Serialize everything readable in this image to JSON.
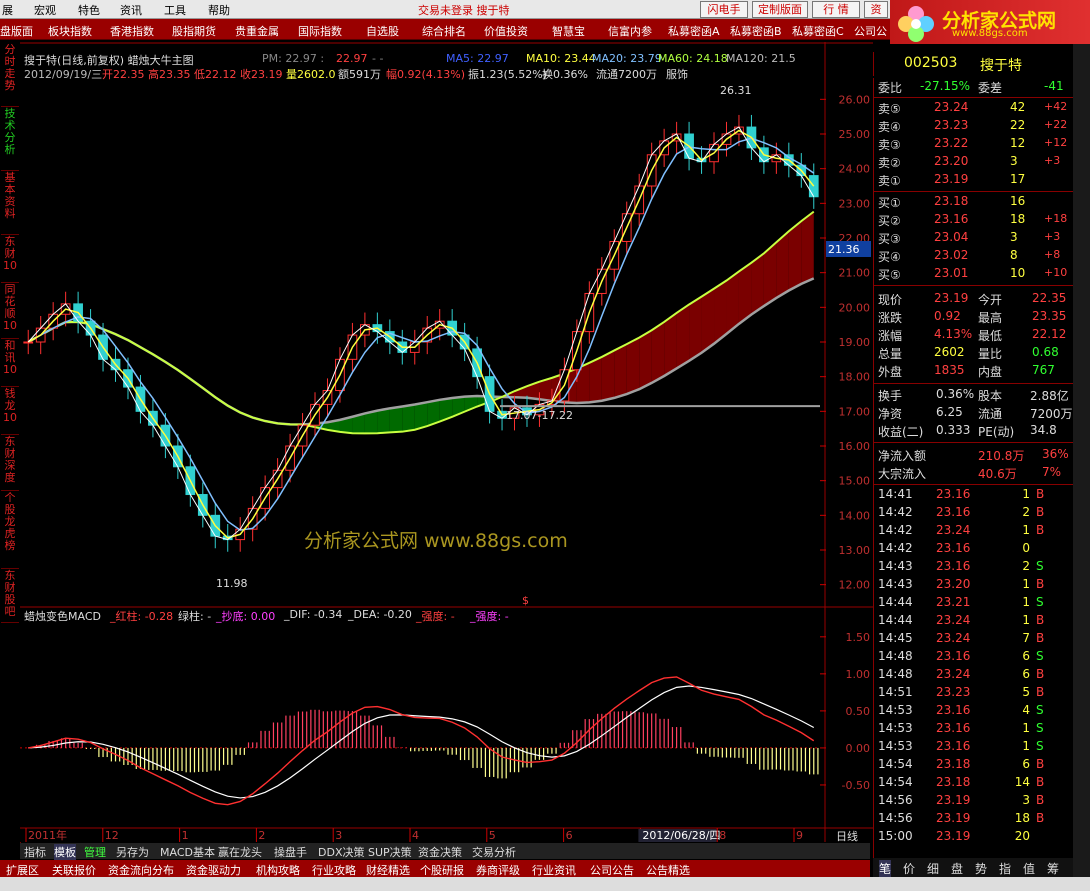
{
  "menu": {
    "items": [
      "展",
      "宏观",
      "特色",
      "资讯",
      "工具",
      "帮助"
    ],
    "status": "交易未登录 搜于特",
    "buttons": [
      "闪电手",
      "定制版面",
      "行 情",
      "资"
    ]
  },
  "nav": {
    "items": [
      "盘版面",
      "板块指数",
      "香港指数",
      "股指期货",
      "贵重金属",
      "国际指数",
      "自选股",
      "综合排名",
      "价值投资",
      "智慧宝",
      "信富内参",
      "私募密函A",
      "私募密函B",
      "私募密函C",
      "公司公"
    ]
  },
  "logo": {
    "title": "分析家公式网",
    "url": "www.88gs.com"
  },
  "left_tabs": [
    "分时走势",
    "技术分析",
    "基本资料",
    "东财10",
    "同花顺10",
    "和讯10",
    "钱龙10",
    "东财深度",
    "个股龙虎榜",
    "东财股吧"
  ],
  "chart_header": {
    "line1_title": "搜于特(日线,前复权) 蜡烛大牛主图",
    "line1_pm": "PM: 22.97 :",
    "line1_pm2": "22.97",
    "line1_dash": "- -",
    "ma5": "MA5: 22.97",
    "ma10": "MA10: 23.44",
    "ma20": "MA20: 23.79",
    "ma60": "MA60: 24.18",
    "ma120": "MA120: 21.5",
    "line2_date": "2012/09/19/三",
    "line2_open": "开22.35",
    "line2_high": "高23.35",
    "line2_low": "低22.12",
    "line2_close": "收23.19",
    "line2_vol": "量2602.0",
    "line2_amt": "额591万",
    "line2_fu": "幅0.92(4.13%)",
    "line2_zhen": "振1.23(5.52%)",
    "line2_huan": "换0.36%",
    "line2_flow": "流通7200万",
    "line2_ind": "服饰"
  },
  "chart_data": [
    {
      "type": "line",
      "title": "搜于特(日线,前复权) 蜡烛大牛主图",
      "ylim": [
        11.5,
        26.5
      ],
      "y_ticks": [
        "26.00",
        "25.00",
        "24.00",
        "23.00",
        "22.00",
        "21.00",
        "20.00",
        "19.00",
        "18.00",
        "17.00",
        "16.00",
        "15.00",
        "14.00",
        "13.00",
        "12.00"
      ],
      "x_ticks": [
        "2011年",
        "12",
        "1",
        "2",
        "3",
        "4",
        "5",
        "6",
        "2012/06/28/四",
        "8",
        "9"
      ],
      "annotations": [
        "26.31",
        "11.98",
        "17.07-17.22",
        "21.36",
        "$"
      ],
      "close": [
        19.0,
        19.4,
        19.8,
        20.1,
        19.6,
        19.2,
        18.5,
        18.2,
        17.7,
        17.0,
        16.6,
        16.0,
        15.4,
        14.6,
        14.0,
        13.4,
        13.3,
        13.6,
        14.2,
        14.8,
        15.3,
        16.0,
        16.6,
        17.2,
        17.6,
        18.5,
        19.2,
        19.5,
        19.3,
        19.0,
        18.7,
        19.0,
        19.4,
        19.6,
        19.2,
        18.8,
        18.0,
        17.0,
        16.8,
        17.1,
        16.9,
        17.2,
        17.3,
        18.2,
        19.3,
        20.4,
        21.1,
        21.9,
        22.7,
        23.5,
        24.4,
        24.8,
        25.0,
        24.3,
        24.2,
        24.7,
        25.0,
        25.2,
        24.6,
        24.2,
        24.4,
        24.1,
        23.8,
        23.19
      ]
    },
    {
      "type": "bar",
      "title": "蜡烛变色MACD",
      "ylim": [
        -1.0,
        1.7
      ],
      "y_ticks": [
        "1.50",
        "1.00",
        "0.50",
        "0.00",
        "-0.50"
      ],
      "labels": {
        "red": "_红柱: -0.28",
        "green": "绿柱: -",
        "chaodi": "_抄底: 0.00",
        "dif": "_DIF: -0.34",
        "dea": "_DEA: -0.20",
        "qiangdu1": "_强度: -",
        "qiangdu2": "_强度: -"
      }
    }
  ],
  "right_panel": {
    "code": "002503",
    "name": "搜于特",
    "weibi_label": "委比",
    "weibi": "-27.15%",
    "weicha_label": "委差",
    "weicha": "-41",
    "sell": [
      {
        "label": "卖⑤",
        "price": "23.24",
        "vol": "42",
        "chg": "+42"
      },
      {
        "label": "卖④",
        "price": "23.23",
        "vol": "22",
        "chg": "+22"
      },
      {
        "label": "卖③",
        "price": "23.22",
        "vol": "12",
        "chg": "+12"
      },
      {
        "label": "卖②",
        "price": "23.20",
        "vol": "3",
        "chg": "+3"
      },
      {
        "label": "卖①",
        "price": "23.19",
        "vol": "17",
        "chg": ""
      }
    ],
    "buy": [
      {
        "label": "买①",
        "price": "23.18",
        "vol": "16",
        "chg": ""
      },
      {
        "label": "买②",
        "price": "23.16",
        "vol": "18",
        "chg": "+18"
      },
      {
        "label": "买③",
        "price": "23.04",
        "vol": "3",
        "chg": "+3"
      },
      {
        "label": "买④",
        "price": "23.02",
        "vol": "8",
        "chg": "+8"
      },
      {
        "label": "买⑤",
        "price": "23.01",
        "vol": "10",
        "chg": "+10"
      }
    ],
    "quote": [
      {
        "l1": "现价",
        "v1": "23.19",
        "l2": "今开",
        "v2": "22.35"
      },
      {
        "l1": "涨跌",
        "v1": "0.92",
        "l2": "最高",
        "v2": "23.35"
      },
      {
        "l1": "涨幅",
        "v1": "4.13%",
        "l2": "最低",
        "v2": "22.12"
      },
      {
        "l1": "总量",
        "v1": "2602",
        "l2": "量比",
        "v2": "0.68"
      },
      {
        "l1": "外盘",
        "v1": "1835",
        "l2": "内盘",
        "v2": "767"
      }
    ],
    "fund": [
      {
        "l1": "换手",
        "v1": "0.36%",
        "l2": "股本",
        "v2": "2.88亿"
      },
      {
        "l1": "净资",
        "v1": "6.25",
        "l2": "流通",
        "v2": "7200万"
      },
      {
        "l1": "收益(二)",
        "v1": "0.333",
        "l2": "PE(动)",
        "v2": "34.8"
      }
    ],
    "flow": [
      {
        "label": "净流入额",
        "value": "210.8万",
        "pct": "36%"
      },
      {
        "label": "大宗流入",
        "value": "40.6万",
        "pct": "7%"
      }
    ],
    "ticks": [
      [
        "14:41",
        "23.16",
        "1",
        "B"
      ],
      [
        "14:42",
        "23.16",
        "2",
        "B"
      ],
      [
        "14:42",
        "23.24",
        "1",
        "B"
      ],
      [
        "14:42",
        "23.16",
        "0",
        ""
      ],
      [
        "14:43",
        "23.16",
        "2",
        "S"
      ],
      [
        "14:43",
        "23.20",
        "1",
        "B"
      ],
      [
        "14:44",
        "23.21",
        "1",
        "S"
      ],
      [
        "14:44",
        "23.24",
        "1",
        "B"
      ],
      [
        "14:45",
        "23.24",
        "7",
        "B"
      ],
      [
        "14:48",
        "23.16",
        "6",
        "S"
      ],
      [
        "14:48",
        "23.24",
        "6",
        "B"
      ],
      [
        "14:51",
        "23.23",
        "5",
        "B"
      ],
      [
        "14:53",
        "23.16",
        "4",
        "S"
      ],
      [
        "14:53",
        "23.16",
        "1",
        "S"
      ],
      [
        "14:53",
        "23.16",
        "1",
        "S"
      ],
      [
        "14:54",
        "23.18",
        "6",
        "B"
      ],
      [
        "14:54",
        "23.18",
        "14",
        "B"
      ],
      [
        "14:56",
        "23.19",
        "3",
        "B"
      ],
      [
        "14:56",
        "23.19",
        "18",
        "B"
      ],
      [
        "15:00",
        "23.19",
        "20",
        ""
      ]
    ]
  },
  "bottom_tabs": [
    "指标",
    "模板",
    "管理",
    "另存为",
    "MACD基本",
    "赢在龙头",
    "操盘手",
    "DDX决策",
    "SUP决策",
    "资金决策",
    "交易分析"
  ],
  "bottom_bar": [
    "扩展区",
    "关联报价",
    "资金流向分布",
    "资金驱动力",
    "机构攻略",
    "行业攻略",
    "财经精选",
    "个股研报",
    "券商评级",
    "行业资讯",
    "公司公告",
    "公告精选"
  ],
  "right_tabs": [
    "笔",
    "价",
    "细",
    "盘",
    "势",
    "指",
    "值",
    "筹"
  ],
  "chart_controls": {
    "period": "日线",
    "plus": "+",
    "minus": "-",
    "zero": "0"
  },
  "watermark": "分析家公式网 www.88gs.com",
  "colors": {
    "up": "#ff3030",
    "down": "#30d0d0",
    "green": "#00c000",
    "yellow": "#ffff00",
    "accent": "#9a0000"
  }
}
